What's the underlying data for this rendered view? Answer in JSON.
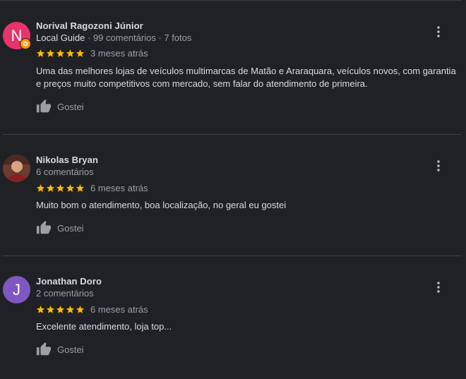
{
  "colors": {
    "background": "#202124",
    "star": "#fbbc04",
    "guide_badge": "#f29900",
    "text_primary": "#dadce0",
    "text_secondary": "#9aa0a6"
  },
  "reviews": [
    {
      "avatar_letter": "N",
      "avatar_color": "#e8336b",
      "name": "Norival Ragozoni Júnior",
      "guide_label": "Local Guide",
      "meta": " · 99 comentários · 7 fotos",
      "stars": 5,
      "age": "3 meses atrás",
      "text": "Uma das melhores lojas de veículos multimarcas de Matão e Araraquara, veículos novos, com garantia e preços muito competitivos com mercado, sem falar do atendimento de primeira.",
      "like_label": "Gostei"
    },
    {
      "avatar_photo": true,
      "name": "Nikolas Bryan",
      "meta": "6 comentários",
      "stars": 5,
      "age": "6 meses atrás",
      "text": "Muito bom o atendimento, boa localização, no geral eu gostei",
      "like_label": "Gostei"
    },
    {
      "avatar_letter": "J",
      "avatar_color": "#7e57c2",
      "name": "Jonathan Doro",
      "meta": "2 comentários",
      "stars": 5,
      "age": "6 meses atrás",
      "text": "Excelente atendimento, loja top...",
      "like_label": "Gostei"
    }
  ]
}
